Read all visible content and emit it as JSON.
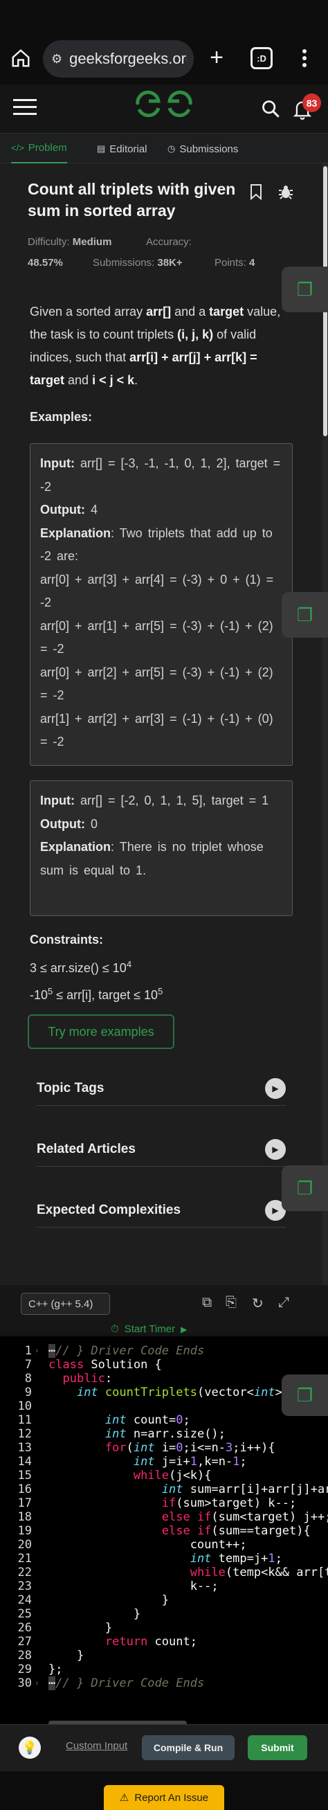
{
  "browser": {
    "url": "geeksforgeeks.org",
    "tab_count": ":D"
  },
  "header": {
    "logo": "GG",
    "notification_count": "83"
  },
  "tabs": [
    {
      "label": "Problem",
      "icon": "code-icon"
    },
    {
      "label": "Editorial",
      "icon": "document-icon"
    },
    {
      "label": "Submissions",
      "icon": "clock-icon"
    }
  ],
  "problem": {
    "title": "Count all triplets with given sum in sorted array",
    "difficulty_label": "Difficulty:",
    "difficulty": "Medium",
    "accuracy_label": "Accuracy:",
    "accuracy": "48.57%",
    "submissions_label": "Submissions:",
    "submissions": "38K+",
    "points_label": "Points:",
    "points": "4",
    "statement": {
      "p1": "Given a sorted array ",
      "arr": "arr[]",
      "p2": " and a ",
      "target": "target",
      "p3": " value, the task is to count triplets ",
      "ijk": "(i, j, k)",
      "p4": " of valid indices, such that ",
      "cond": "arr[i] + arr[j] + arr[k] = target",
      "p5": " and ",
      "order": "i < j < k",
      "p6": "."
    },
    "examples_label": "Examples:",
    "example1": {
      "input_label": "Input:",
      "input": " arr[] = [-3, -1, -1, 0, 1, 2], target = -2",
      "output_label": "Output:",
      "output": " 4",
      "explanation_label": "Explanation",
      "explanation": ": Two triplets that add up to -2 are:",
      "lines": [
        "arr[0] + arr[3] + arr[4] = (-3) + 0 + (1) = -2",
        "arr[0] + arr[1] + arr[5] = (-3) + (-1) + (2) = -2",
        "arr[0] + arr[2] + arr[5] = (-3) + (-1) + (2) = -2",
        "arr[1] + arr[2] + arr[3] = (-1) + (-1) + (0) = -2"
      ]
    },
    "example2": {
      "input_label": "Input:",
      "input": " arr[] = [-2, 0, 1, 1, 5], target = 1",
      "output_label": "Output:",
      "output": " 0",
      "explanation_label": "Explanation",
      "explanation": ": There is no triplet whose sum is equal to 1."
    },
    "constraints_label": "Constraints:",
    "constraint1_a": "3 ≤ arr.size() ≤ 10",
    "constraint1_exp": "4",
    "constraint2_a": "-10",
    "constraint2_exp1": "5",
    "constraint2_b": " ≤ arr[i], target ≤ 10",
    "constraint2_exp2": "5",
    "try_more": "Try more examples",
    "accordions": [
      "Topic Tags",
      "Related Articles",
      "Expected Complexities"
    ]
  },
  "editor": {
    "language": "C++ (g++ 5.4)",
    "timer_label": "Start Timer",
    "line_numbers": [
      "1",
      "7",
      "8",
      "9",
      "10",
      "11",
      "12",
      "13",
      "14",
      "15",
      "16",
      "17",
      "18",
      "19",
      "20",
      "21",
      "22",
      "23",
      "24",
      "25",
      "26",
      "27",
      "28",
      "29",
      "30"
    ]
  },
  "bottom": {
    "custom_input": "Custom Input",
    "compile": "Compile & Run",
    "submit": "Submit",
    "report": "Report An Issue"
  },
  "colors": {
    "accent": "#2f8d46",
    "background": "#1e1e1e",
    "code_background": "#000000",
    "report": "#f5b400"
  }
}
